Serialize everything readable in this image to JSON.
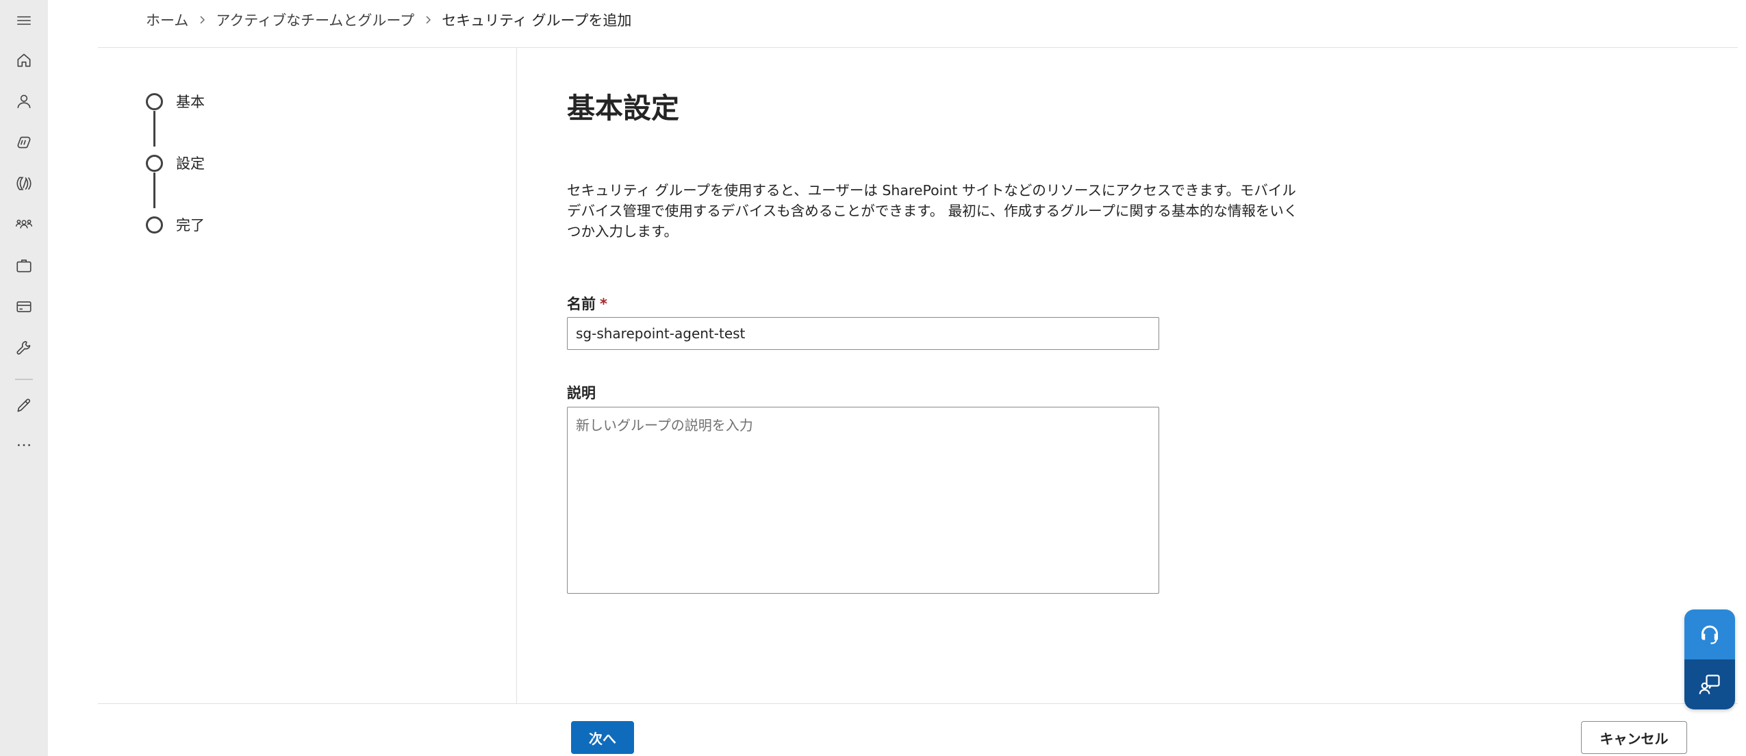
{
  "nav": {
    "items": [
      {
        "name": "menu-icon"
      },
      {
        "name": "home-icon"
      },
      {
        "name": "user-icon"
      },
      {
        "name": "copilot-icon"
      },
      {
        "name": "admin-icon"
      },
      {
        "name": "teams-icon"
      },
      {
        "name": "briefcase-icon"
      },
      {
        "name": "billing-card-icon"
      },
      {
        "name": "wrench-icon"
      },
      {
        "name": "pencil-icon"
      },
      {
        "name": "more-icon"
      }
    ]
  },
  "breadcrumb": {
    "items": [
      "ホーム",
      "アクティブなチームとグループ",
      "セキュリティ グループを追加"
    ],
    "separator": ">"
  },
  "stepper": {
    "steps": [
      "基本",
      "設定",
      "完了"
    ]
  },
  "main": {
    "title": "基本設定",
    "intro": "セキュリティ グループを使用すると、ユーザーは SharePoint サイトなどのリソースにアクセスできます。モバイル デバイス管理で使用するデバイスも含めることができます。 最初に、作成するグループに関する基本的な情報をいくつか入力します。",
    "name_label": "名前",
    "required_mark": "*",
    "name_value": "sg-sharepoint-agent-test",
    "description_label": "説明",
    "description_placeholder": "新しいグループの説明を入力"
  },
  "footer": {
    "next_label": "次へ",
    "cancel_label": "キャンセル"
  },
  "colors": {
    "accent": "#0f6cbd",
    "rail_bg": "#ebebeb",
    "help_top": "#2b88d8",
    "help_bottom": "#0f4f8f",
    "required": "#a4262c"
  }
}
